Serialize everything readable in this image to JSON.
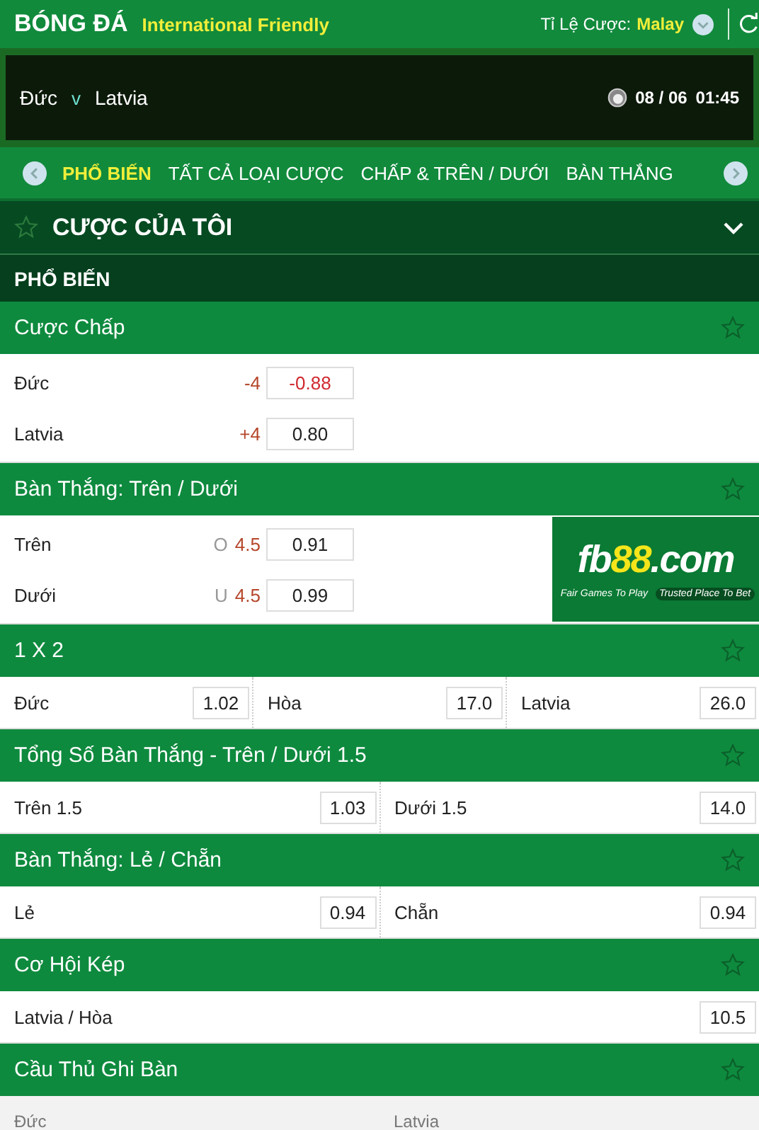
{
  "header": {
    "title": "BÓNG ĐÁ",
    "league": "International Friendly",
    "odds_label": "Tỉ Lệ Cược:",
    "odds_type": "Malay"
  },
  "match": {
    "home": "Đức",
    "vs": "v",
    "away": "Latvia",
    "date": "08 / 06",
    "time": "01:45"
  },
  "tabs": [
    {
      "label": "PHỔ BIẾN",
      "selected": true
    },
    {
      "label": "TẤT CẢ LOẠI CƯỢC",
      "selected": false
    },
    {
      "label": "CHẤP & TRÊN / DƯỚI",
      "selected": false
    },
    {
      "label": "BÀN THẮNG",
      "selected": false
    }
  ],
  "my_bets": {
    "title": "CƯỢC CỦA TÔI",
    "expanded": false
  },
  "section": "PHỔ BIẾN",
  "markets": [
    {
      "kind": "lines",
      "title": "Cược Chấp",
      "rows": [
        {
          "name": "Đức",
          "prefix": "",
          "line": "-4",
          "odds": "-0.88",
          "negative": true
        },
        {
          "name": "Latvia",
          "prefix": "",
          "line": "+4",
          "odds": "0.80",
          "negative": false
        }
      ]
    },
    {
      "kind": "lines",
      "title": "Bàn Thắng: Trên / Dưới",
      "banner": {
        "logo": [
          "fb",
          "88",
          ".com"
        ],
        "taglines": [
          "Fair Games To Play",
          "Trusted Place To Bet"
        ]
      },
      "rows": [
        {
          "name": "Trên",
          "prefix": "O",
          "line": "4.5",
          "odds": "0.91",
          "negative": false
        },
        {
          "name": "Dưới",
          "prefix": "U",
          "line": "4.5",
          "odds": "0.99",
          "negative": false
        }
      ]
    },
    {
      "kind": "cells",
      "title": "1 X 2",
      "cells": [
        {
          "name": "Đức",
          "odds": "1.02"
        },
        {
          "name": "Hòa",
          "odds": "17.0"
        },
        {
          "name": "Latvia",
          "odds": "26.0"
        }
      ]
    },
    {
      "kind": "cells",
      "title": "Tổng Số Bàn Thắng - Trên / Dưới 1.5",
      "cells": [
        {
          "name": "Trên 1.5",
          "odds": "1.03"
        },
        {
          "name": "Dưới 1.5",
          "odds": "14.0"
        }
      ]
    },
    {
      "kind": "cells",
      "title": "Bàn Thắng: Lẻ / Chẵn",
      "cells": [
        {
          "name": "Lẻ",
          "odds": "0.94"
        },
        {
          "name": "Chẵn",
          "odds": "0.94"
        }
      ]
    },
    {
      "kind": "cells",
      "title": "Cơ Hội Kép",
      "cells": [
        {
          "name": "Latvia / Hòa",
          "odds": "10.5"
        }
      ]
    },
    {
      "kind": "columns",
      "title": "Cầu Thủ Ghi Bàn",
      "columns": [
        "Đức",
        "Latvia"
      ]
    }
  ]
}
